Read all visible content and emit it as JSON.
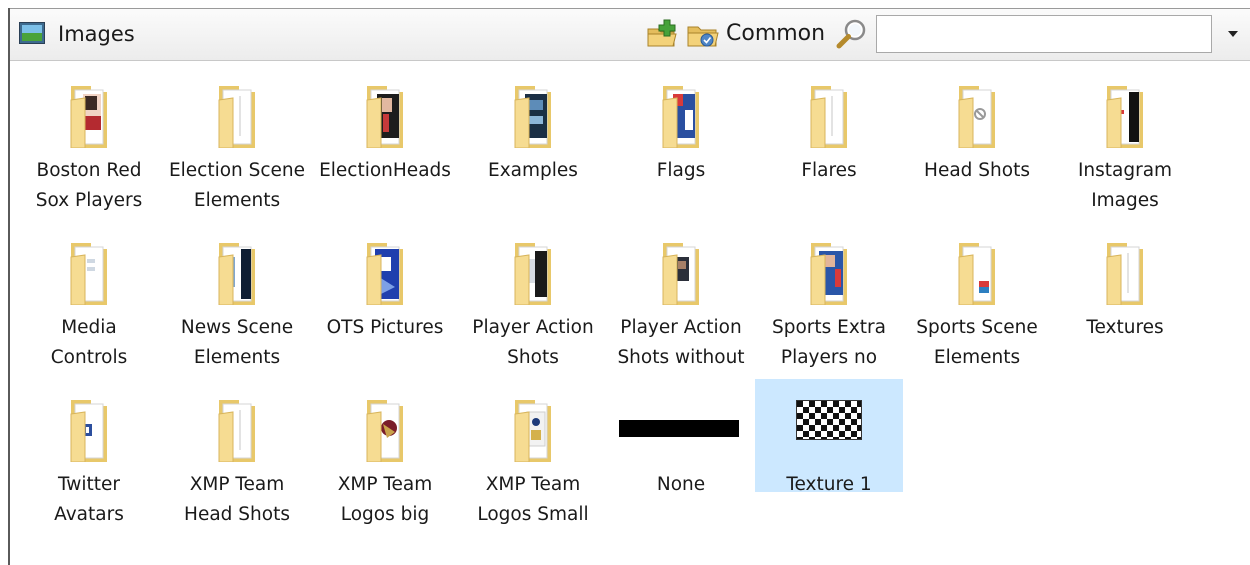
{
  "window": {
    "title": "Images",
    "title_icon": "image-panel-icon"
  },
  "toolbar": {
    "add_folder_icon": "add-folder-icon",
    "common_folder_icon": "common-folder-icon",
    "common_label": "Common",
    "search_icon": "search-icon",
    "search_value": "",
    "dropdown_icon": "chevron-down-icon"
  },
  "items": [
    {
      "label": "Boston Red\nSox Players",
      "icon": "folder-icon"
    },
    {
      "label": "Election Scene\nElements",
      "icon": "folder-icon"
    },
    {
      "label": "ElectionHeads",
      "icon": "folder-icon"
    },
    {
      "label": "Examples",
      "icon": "folder-icon"
    },
    {
      "label": "Flags",
      "icon": "folder-icon"
    },
    {
      "label": "Flares",
      "icon": "folder-icon"
    },
    {
      "label": "Head Shots",
      "icon": "folder-icon"
    },
    {
      "label": "Instagram\nImages",
      "icon": "folder-icon"
    },
    {
      "label": "Media\nControls",
      "icon": "folder-icon"
    },
    {
      "label": "News Scene\nElements",
      "icon": "folder-icon"
    },
    {
      "label": "OTS Pictures",
      "icon": "folder-icon"
    },
    {
      "label": "Player Action\nShots",
      "icon": "folder-icon"
    },
    {
      "label": "Player Action\nShots without",
      "icon": "folder-icon"
    },
    {
      "label": "Sports Extra\nPlayers no",
      "icon": "folder-icon"
    },
    {
      "label": "Sports Scene\nElements",
      "icon": "folder-icon"
    },
    {
      "label": "Textures",
      "icon": "folder-icon"
    },
    {
      "label": "Twitter\nAvatars",
      "icon": "folder-icon"
    },
    {
      "label": "XMP Team\nHead Shots",
      "icon": "folder-icon"
    },
    {
      "label": "XMP Team\nLogos big",
      "icon": "folder-icon"
    },
    {
      "label": "XMP Team\nLogos Small",
      "icon": "folder-icon"
    },
    {
      "label": "None",
      "icon": "none-swatch-icon"
    },
    {
      "label": "Texture 1",
      "icon": "checkerboard-texture-icon",
      "selected": true
    }
  ],
  "colors": {
    "folder_back": "#e8c86a",
    "folder_front": "#f6dc92",
    "paper": "#ffffff",
    "selection": "#cce8ff"
  }
}
